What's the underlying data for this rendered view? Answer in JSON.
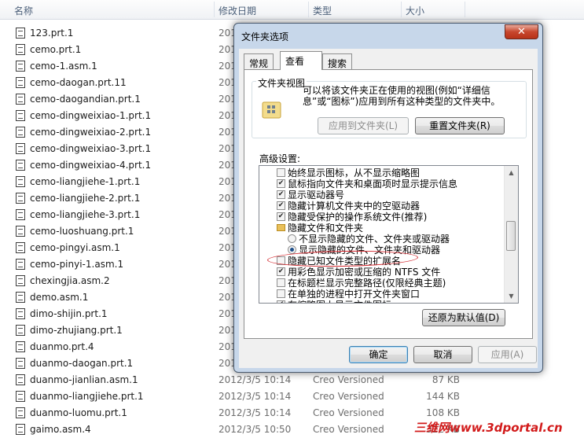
{
  "columns": {
    "name": "名称",
    "date": "修改日期",
    "type": "类型",
    "size": "大小"
  },
  "files": [
    {
      "name": "123.prt.1",
      "date": "201",
      "type": "",
      "size": ""
    },
    {
      "name": "cemo.prt.1",
      "date": "201",
      "type": "",
      "size": ""
    },
    {
      "name": "cemo-1.asm.1",
      "date": "201",
      "type": "",
      "size": ""
    },
    {
      "name": "cemo-daogan.prt.11",
      "date": "201",
      "type": "",
      "size": ""
    },
    {
      "name": "cemo-daogandian.prt.1",
      "date": "201",
      "type": "",
      "size": ""
    },
    {
      "name": "cemo-dingweixiao-1.prt.1",
      "date": "201",
      "type": "",
      "size": ""
    },
    {
      "name": "cemo-dingweixiao-2.prt.1",
      "date": "201",
      "type": "",
      "size": ""
    },
    {
      "name": "cemo-dingweixiao-3.prt.1",
      "date": "201",
      "type": "",
      "size": ""
    },
    {
      "name": "cemo-dingweixiao-4.prt.1",
      "date": "201",
      "type": "",
      "size": ""
    },
    {
      "name": "cemo-liangjiehe-1.prt.1",
      "date": "201",
      "type": "",
      "size": ""
    },
    {
      "name": "cemo-liangjiehe-2.prt.1",
      "date": "201",
      "type": "",
      "size": ""
    },
    {
      "name": "cemo-liangjiehe-3.prt.1",
      "date": "201",
      "type": "",
      "size": ""
    },
    {
      "name": "cemo-luoshuang.prt.1",
      "date": "201",
      "type": "",
      "size": ""
    },
    {
      "name": "cemo-pingyi.asm.1",
      "date": "201",
      "type": "",
      "size": ""
    },
    {
      "name": "cemo-pinyi-1.asm.1",
      "date": "201",
      "type": "",
      "size": ""
    },
    {
      "name": "chexingjia.asm.2",
      "date": "201",
      "type": "",
      "size": ""
    },
    {
      "name": "demo.asm.1",
      "date": "201",
      "type": "",
      "size": ""
    },
    {
      "name": "dimo-shijin.prt.1",
      "date": "201",
      "type": "",
      "size": ""
    },
    {
      "name": "dimo-zhujiang.prt.1",
      "date": "201",
      "type": "",
      "size": ""
    },
    {
      "name": "duanmo.prt.4",
      "date": "201",
      "type": "",
      "size": ""
    },
    {
      "name": "duanmo-daogan.prt.1",
      "date": "201",
      "type": "",
      "size": ""
    },
    {
      "name": "duanmo-jianlian.asm.1",
      "date": "2012/3/5 10:14",
      "type": "Creo Versioned",
      "size": "87 KB"
    },
    {
      "name": "duanmo-liangjiehe.prt.1",
      "date": "2012/3/5 10:14",
      "type": "Creo Versioned",
      "size": "144 KB"
    },
    {
      "name": "duanmo-luomu.prt.1",
      "date": "2012/3/5 10:14",
      "type": "Creo Versioned",
      "size": "108 KB"
    },
    {
      "name": "gaimo.asm.4",
      "date": "2012/3/5 10:50",
      "type": "Creo Versioned",
      "size": "322 KB"
    }
  ],
  "dialog": {
    "title": "文件夹选项",
    "close_glyph": "✕",
    "tabs": [
      {
        "label": "常规"
      },
      {
        "label": "查看"
      },
      {
        "label": "搜索"
      }
    ],
    "folder_view": {
      "group_label": "文件夹视图",
      "description": "可以将该文件夹正在使用的视图(例如“详细信息”或“图标”)应用到所有这种类型的文件夹中。",
      "apply_button": "应用到文件夹(L)",
      "reset_button": "重置文件夹(R)"
    },
    "advanced_label": "高级设置:",
    "advanced_items": [
      {
        "kind": "checkbox",
        "checked": false,
        "label": "始终显示图标，从不显示缩略图"
      },
      {
        "kind": "checkbox",
        "checked": true,
        "label": "鼠标指向文件夹和桌面项时显示提示信息"
      },
      {
        "kind": "checkbox",
        "checked": true,
        "label": "显示驱动器号"
      },
      {
        "kind": "checkbox",
        "checked": true,
        "label": "隐藏计算机文件夹中的空驱动器"
      },
      {
        "kind": "checkbox",
        "checked": true,
        "label": "隐藏受保护的操作系统文件(推荐)"
      },
      {
        "kind": "folder",
        "checked": false,
        "label": "隐藏文件和文件夹"
      },
      {
        "kind": "radio",
        "checked": false,
        "label": "不显示隐藏的文件、文件夹或驱动器"
      },
      {
        "kind": "radio",
        "checked": true,
        "label": "显示隐藏的文件、文件夹和驱动器"
      },
      {
        "kind": "checkbox",
        "checked": false,
        "label": "隐藏已知文件类型的扩展名"
      },
      {
        "kind": "checkbox",
        "checked": true,
        "label": "用彩色显示加密或压缩的 NTFS 文件"
      },
      {
        "kind": "checkbox",
        "checked": false,
        "label": "在标题栏显示完整路径(仅限经典主题)"
      },
      {
        "kind": "checkbox",
        "checked": false,
        "label": "在单独的进程中打开文件夹窗口"
      },
      {
        "kind": "checkbox",
        "checked": true,
        "label": "在缩略图上显示文件图标"
      }
    ],
    "restore_button": "还原为默认值(D)",
    "ok_button": "确定",
    "cancel_button": "取消",
    "apply_button": "应用(A)"
  },
  "watermark": "三维网www.3dportal.cn",
  "colors": {
    "dialog_frame": "#c7d7ea",
    "close_button": "#c7462d",
    "annotation": "#d3262c",
    "watermark": "#d21a1a"
  }
}
